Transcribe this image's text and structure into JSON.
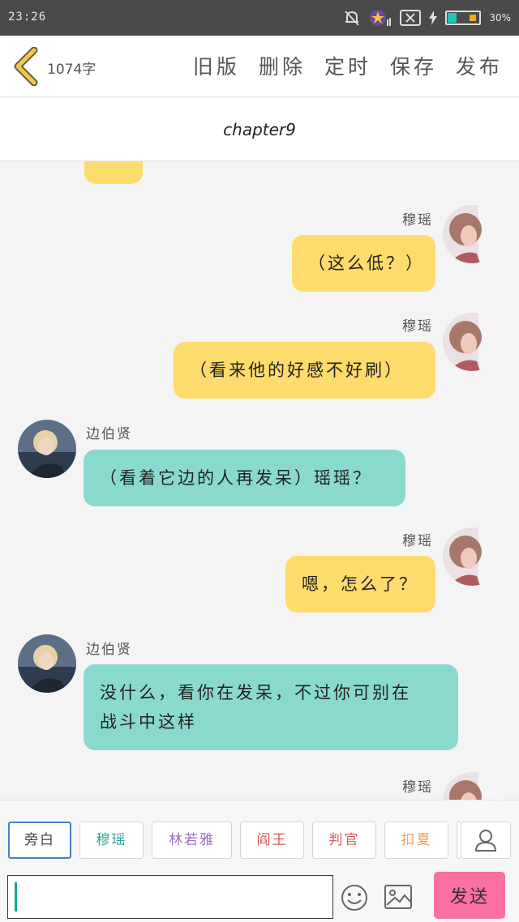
{
  "status_bar": {
    "time": "23:26",
    "battery_percent": "30%",
    "battery_level": 0.3,
    "icons": [
      "bell-off-icon",
      "star-notification-icon",
      "sim-x-icon",
      "charging-icon",
      "battery-icon"
    ]
  },
  "toolbar": {
    "word_count": "1074字",
    "actions": [
      "旧版",
      "删除",
      "定时",
      "保存",
      "发布"
    ]
  },
  "chapter": {
    "title": "chapter9"
  },
  "messages": [
    {
      "side": "right",
      "sender": "穆瑶",
      "text": "（这么低？）"
    },
    {
      "side": "right",
      "sender": "穆瑶",
      "text": "（看来他的好感不好刷）"
    },
    {
      "side": "left",
      "sender": "边伯贤",
      "text": "（看着它边的人再发呆）瑶瑶？"
    },
    {
      "side": "right",
      "sender": "穆瑶",
      "text": "嗯，怎么了？"
    },
    {
      "side": "left",
      "sender": "边伯贤",
      "text_line1": "没什么，看你在发呆，不过你可别在",
      "text_line2": "战斗中这样"
    },
    {
      "side": "right",
      "sender": "穆瑶"
    }
  ],
  "characters": [
    {
      "label": "旁白",
      "color": "#444444",
      "selected": true
    },
    {
      "label": "穆瑶",
      "color": "#2aa89a"
    },
    {
      "label": "林若雅",
      "color": "#9b6fc4"
    },
    {
      "label": "阎王",
      "color": "#e05050"
    },
    {
      "label": "判官",
      "color": "#e35a5a"
    },
    {
      "label": "扣夏",
      "color": "#f0a060"
    }
  ],
  "input": {
    "placeholder": "",
    "send_label": "发送"
  },
  "colors": {
    "yellow_bubble": "#fddb6d",
    "teal_bubble": "#8ad9cf",
    "send_button": "#fb6fa2",
    "accent_back": "#e6b13c"
  }
}
